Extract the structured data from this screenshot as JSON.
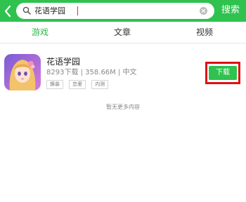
{
  "search": {
    "query": "花语学园",
    "submit_label": "搜索"
  },
  "tabs": [
    {
      "label": "游戏",
      "active": true
    },
    {
      "label": "文章",
      "active": false
    },
    {
      "label": "视频",
      "active": false
    }
  ],
  "results": [
    {
      "name": "花语学园",
      "meta": "8293下载 | 358.66M | 中文",
      "tags": [
        "换装",
        "恋爱",
        "内测"
      ],
      "download_label": "下载"
    }
  ],
  "empty_note": "暂无更多内容",
  "colors": {
    "accent": "#2fc24f",
    "active_tab": "#2fb94a",
    "highlight": "#e01010"
  },
  "icons": {
    "back": "chevron-left-icon",
    "search": "search-icon",
    "clear": "clear-icon"
  }
}
